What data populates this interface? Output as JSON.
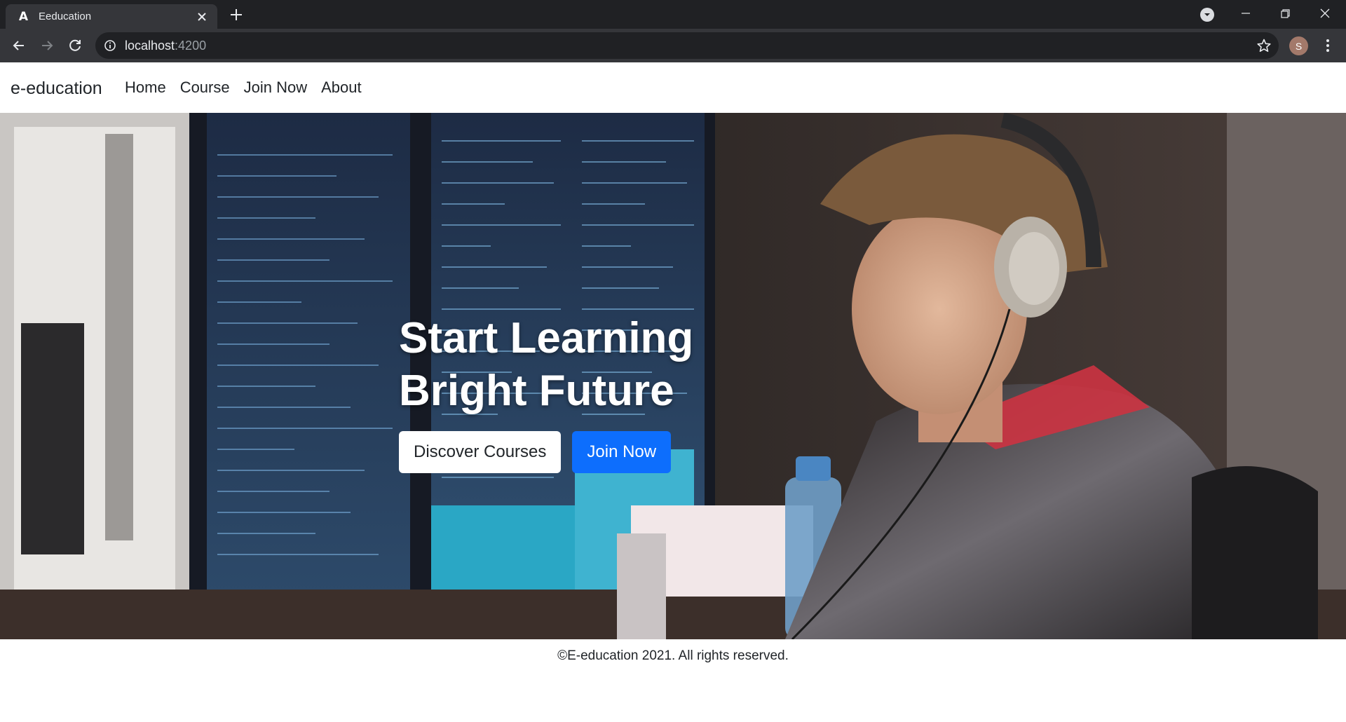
{
  "browser": {
    "tab": {
      "title": "Eeducation",
      "favicon": "angular-logo-icon"
    },
    "address": {
      "host": "localhost",
      "port": ":4200"
    },
    "profile_initial": "S"
  },
  "navbar": {
    "brand": "e-education",
    "links": [
      "Home",
      "Course",
      "Join Now",
      "About"
    ]
  },
  "hero": {
    "title_line1": "Start Learning",
    "title_line2": "Bright Future",
    "primary_button": "Join Now",
    "secondary_button": "Discover Courses"
  },
  "footer": {
    "text": "©E-education 2021. All rights reserved."
  },
  "colors": {
    "primary": "#0d6efd",
    "chrome_dark": "#202124",
    "chrome_toolbar": "#35363a"
  }
}
